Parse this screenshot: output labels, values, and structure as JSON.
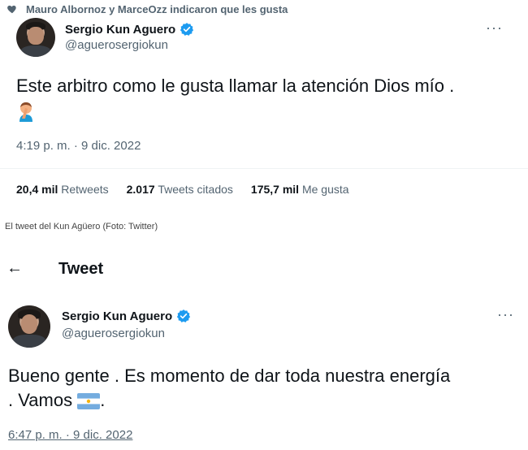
{
  "tweet1": {
    "social_context": "Mauro Albornoz y MarceOzz indicaron que les gusta",
    "author_name": "Sergio Kun Aguero",
    "author_handle": "@aguerosergiokun",
    "text": "Este arbitro como le gusta llamar la atención Dios mío .",
    "emoji": "man-facepalming",
    "timestamp": "4:19 p. m. · 9 dic. 2022",
    "stats": [
      {
        "value": "20,4 mil",
        "label": "Retweets"
      },
      {
        "value": "2.017",
        "label": "Tweets citados"
      },
      {
        "value": "175,7 mil",
        "label": "Me gusta"
      }
    ]
  },
  "caption": "El tweet del Kun Agüero (Foto: Twitter)",
  "tweet2": {
    "header_title": "Tweet",
    "author_name": "Sergio Kun Aguero",
    "author_handle": "@aguerosergiokun",
    "text_line1": "Bueno gente . Es momento de dar toda nuestra energía",
    "text_line2": ". Vamos",
    "text_end": ".",
    "emoji": "argentina-flag",
    "timestamp": "6:47 p. m. · 9 dic. 2022"
  },
  "icons": {
    "more": "···",
    "back": "←"
  },
  "colors": {
    "verified": "#1d9bf0",
    "secondary_text": "#536471"
  }
}
